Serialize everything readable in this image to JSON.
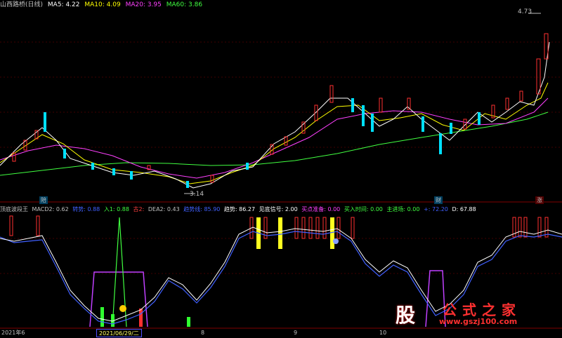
{
  "header": {
    "stock_name": "山西路桥(日线)",
    "ma5_label": "MA5: 4.22",
    "ma10_label": "MA10: 4.09",
    "ma20_label": "MA20: 3.95",
    "ma60_label": "MA60: 3.86",
    "colors": {
      "ma5": "#ffffff",
      "ma10": "#ffff00",
      "ma20": "#ff40ff",
      "ma60": "#40ff40"
    }
  },
  "main_chart": {
    "high_label": "4.73",
    "low_label": "3.14",
    "markers": [
      {
        "text": "陪",
        "kind": "blue"
      },
      {
        "text": "财",
        "kind": "blue"
      },
      {
        "text": "涨",
        "kind": "red"
      }
    ]
  },
  "indicator": {
    "name": "顶底波段王",
    "items": [
      {
        "text": "MACD2: 0.62",
        "color": "#c0c0c0"
      },
      {
        "text": "转势: 0.88",
        "color": "#4060ff"
      },
      {
        "text": "入1: 0.88",
        "color": "#40ff40"
      },
      {
        "text": "古2:",
        "color": "#ff4040"
      },
      {
        "text": "DEA2: 0.43",
        "color": "#c0c0c0"
      },
      {
        "text": "趋势线: 85.90",
        "color": "#4060ff"
      },
      {
        "text": "趋势: 86.27",
        "color": "#ffffff"
      },
      {
        "text": "见底信号: 2.00",
        "color": "#ffffff"
      },
      {
        "text": "买点准备: 0.00",
        "color": "#ff40ff"
      },
      {
        "text": "买入时间: 0.00",
        "color": "#40ff40"
      },
      {
        "text": "主进场: 0.00",
        "color": "#40ff40"
      },
      {
        "text": "+: 72.20",
        "color": "#4060ff"
      },
      {
        "text": "D: 67.88",
        "color": "#ffffff"
      }
    ]
  },
  "x_axis": {
    "labels": [
      "2021年6",
      "8",
      "9",
      "10"
    ],
    "selected_date": "2021/06/29/二"
  },
  "watermark": {
    "glyph": "股",
    "name": "公式之家",
    "url": "www.gszj100.com"
  }
}
